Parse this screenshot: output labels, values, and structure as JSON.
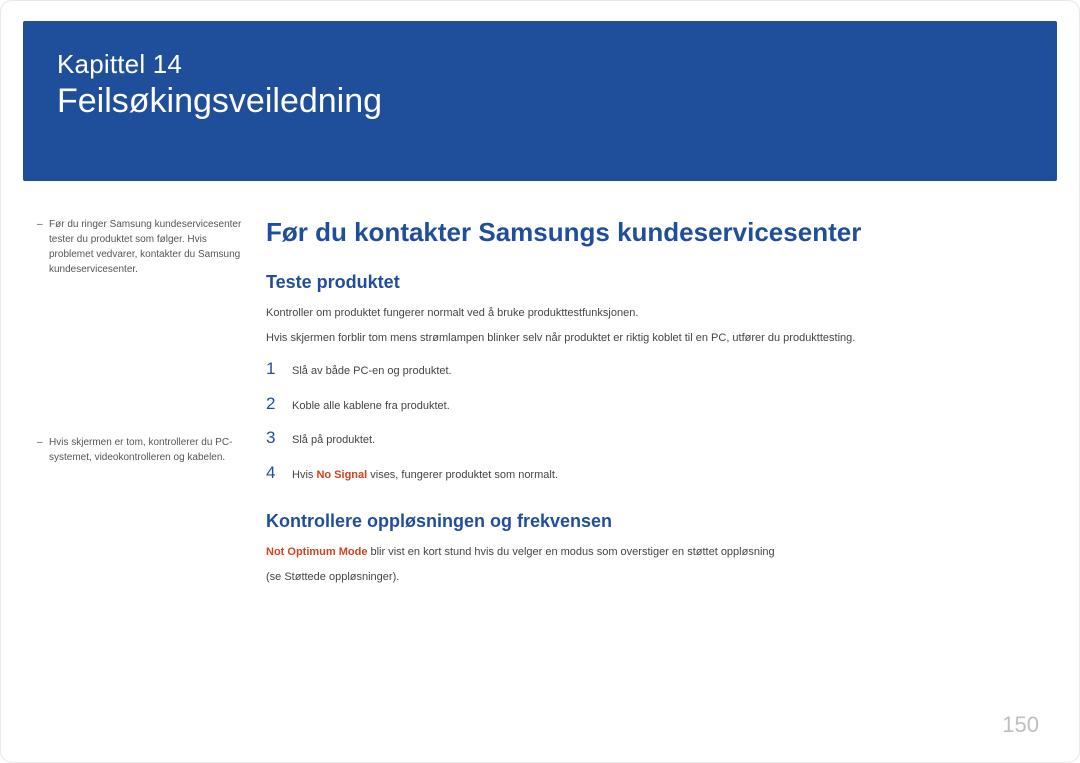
{
  "banner": {
    "chapter": "Kapittel 14",
    "title": "Feilsøkingsveiledning"
  },
  "sidebar": {
    "notes": [
      "Før du ringer Samsung kundeservicesenter tester du produktet som følger. Hvis problemet vedvarer, kontakter du Samsung kundeservicesenter.",
      "Hvis skjermen er tom, kontrollerer du PC-systemet, videokontrolleren og kabelen."
    ]
  },
  "main": {
    "h1": "Før du kontakter Samsungs kundeservicesenter",
    "section1": {
      "heading": "Teste produktet",
      "p1": "Kontroller om produktet fungerer normalt ved å bruke produkttestfunksjonen.",
      "p2": "Hvis skjermen forblir tom mens strømlampen blinker selv når produktet er riktig koblet til en PC, utfører du produkttesting.",
      "steps": [
        "Slå av både PC-en og produktet.",
        "Koble alle kablene fra produktet.",
        "Slå på produktet.",
        {
          "prefix": "Hvis ",
          "highlight": "No Signal",
          "suffix": " vises, fungerer produktet som normalt."
        }
      ]
    },
    "section2": {
      "heading": "Kontrollere oppløsningen og frekvensen",
      "p1_highlight": "Not Optimum Mode",
      "p1_rest": " blir vist en kort stund hvis du velger en modus som overstiger en støttet oppløsning",
      "p2": "(se Støttede oppløsninger)."
    }
  },
  "page_number": "150"
}
